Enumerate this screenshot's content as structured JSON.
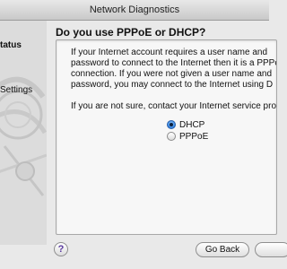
{
  "window": {
    "title": "Network Diagnostics"
  },
  "sidebar": {
    "items": [
      {
        "label": "tatus",
        "state": "active"
      },
      {
        "label": "Settings",
        "state": "inactive"
      }
    ]
  },
  "main": {
    "heading": "Do you use PPPoE or DHCP?",
    "paragraph1": [
      "If your Internet account requires a user name and",
      "password to connect to the Internet then it is a PPPo",
      "connection. If you were not given a user name and",
      "password, you may connect to the Internet using D"
    ],
    "paragraph2": "If you are not sure, contact your Internet service pro",
    "options": [
      {
        "label": "DHCP",
        "selected": true
      },
      {
        "label": "PPPoE",
        "selected": false
      }
    ]
  },
  "footer": {
    "help_icon_glyph": "?",
    "back_label": "Go Back"
  },
  "colors": {
    "accent": "#2f80e0",
    "help": "#5a3aa0"
  }
}
